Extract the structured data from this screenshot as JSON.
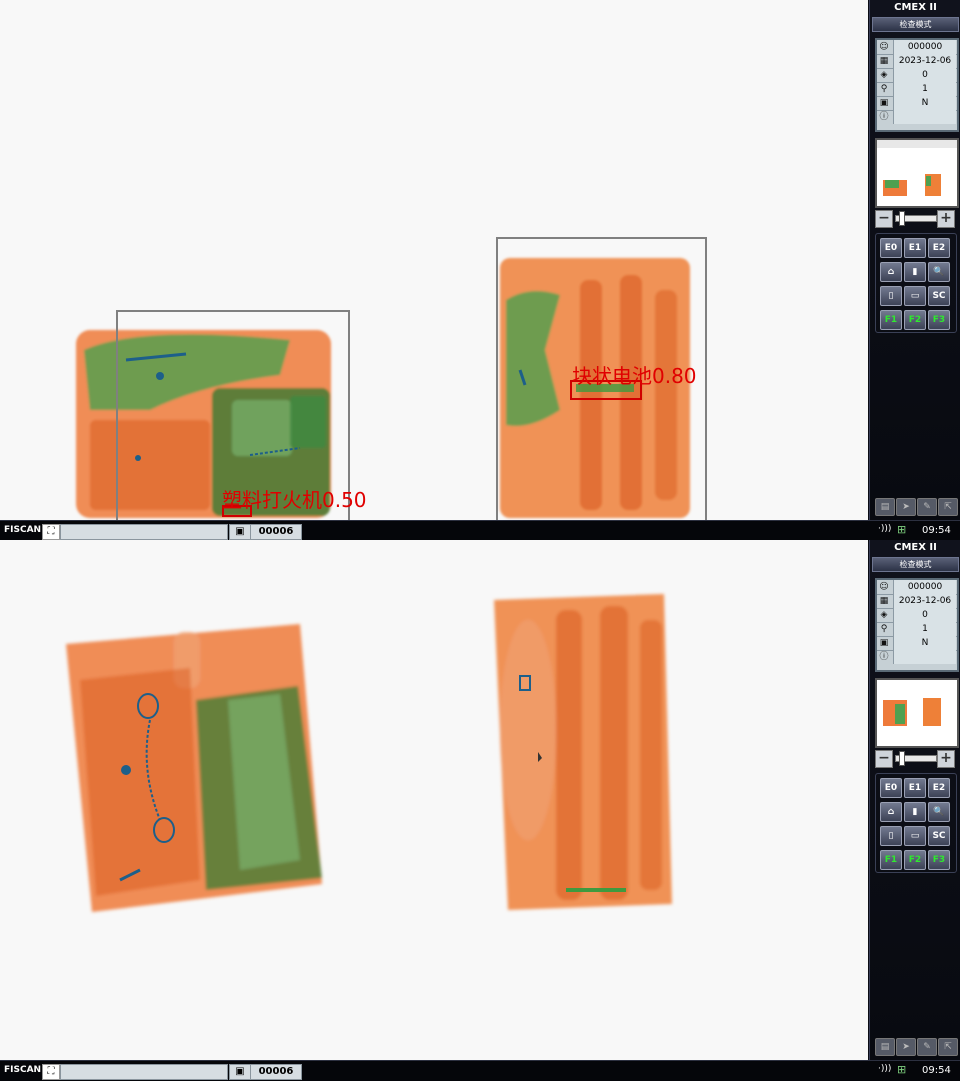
{
  "screens": [
    {
      "app_title": "CMEX II",
      "mode": "检查模式",
      "info": [
        {
          "icon": "operator-icon",
          "value": "000000"
        },
        {
          "icon": "calendar-icon",
          "value": "2023-12-06"
        },
        {
          "icon": "counter-icon",
          "value": "0"
        },
        {
          "icon": "zoom-icon",
          "value": "1"
        },
        {
          "icon": "scanner-icon",
          "value": "N"
        },
        {
          "icon": "info-icon",
          "value": ""
        }
      ],
      "buttons": [
        [
          "E0",
          "E1",
          "E2"
        ],
        [
          "⌂",
          "▮",
          "🔍"
        ],
        [
          "▯",
          "▭",
          "SC"
        ],
        [
          "F1",
          "F2",
          "F3"
        ]
      ],
      "detections": [
        {
          "label": "塑料打火机0.50"
        },
        {
          "label": "块状电池0.80"
        }
      ],
      "statusbar": {
        "brand": "FISCAN",
        "count": "00006",
        "time": "09:54"
      }
    },
    {
      "app_title": "CMEX II",
      "mode": "检查模式",
      "info": [
        {
          "icon": "operator-icon",
          "value": "000000"
        },
        {
          "icon": "calendar-icon",
          "value": "2023-12-06"
        },
        {
          "icon": "counter-icon",
          "value": "0"
        },
        {
          "icon": "zoom-icon",
          "value": "1"
        },
        {
          "icon": "scanner-icon",
          "value": "N"
        },
        {
          "icon": "info-icon",
          "value": ""
        }
      ],
      "buttons": [
        [
          "E0",
          "E1",
          "E2"
        ],
        [
          "⌂",
          "▮",
          "🔍"
        ],
        [
          "▯",
          "▭",
          "SC"
        ],
        [
          "F1",
          "F2",
          "F3"
        ]
      ],
      "detections": [],
      "statusbar": {
        "brand": "FISCAN",
        "count": "00006",
        "time": "09:54"
      }
    }
  ],
  "colors": {
    "organic": "#e8651e",
    "mixed": "#3f9a3f",
    "metal": "#1d5f8a",
    "alert": "#e00000",
    "frame": "#808080"
  }
}
